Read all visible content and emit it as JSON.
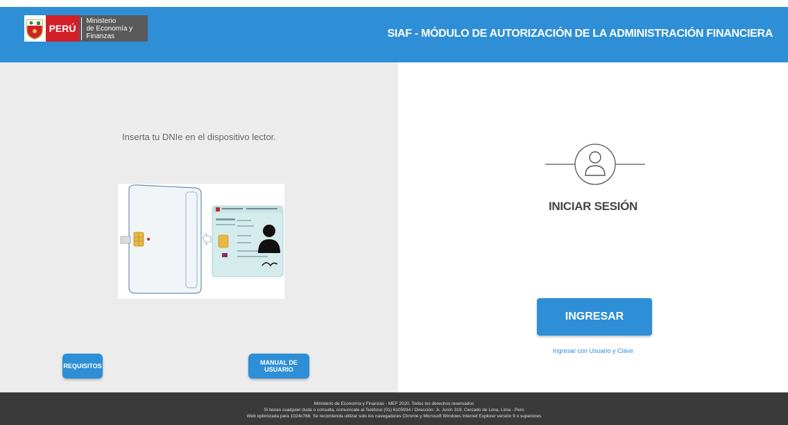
{
  "header": {
    "logo_peru": "PERÚ",
    "logo_ministry_line1": "Ministerio",
    "logo_ministry_line2": "de Economía y Finanzas",
    "title": "SIAF - MÓDULO DE AUTORIZACIÓN DE LA ADMINISTRACIÓN FINANCIERA"
  },
  "left": {
    "instruction": "Inserta tu DNIe en el dispositivo lector.",
    "requisitos_label": "REQUISITOS",
    "manual_label": "MANUAL DE USUARIO"
  },
  "right": {
    "title": "INICIAR SESIÓN",
    "ingresar_label": "INGRESAR",
    "alt_login_link": "Ingresar con Usuario y Clave"
  },
  "footer": {
    "line1": "Ministerio de Economía y Finanzas - MEF 2020. Todos los derechos reservados",
    "line2": "Si tienes cualquier duda o consulta, comunícate al Teléfono (01) 6105934 / Dirección: Jr. Junín 319, Cercado de Lima, Lima - Perú",
    "line3": "Web optimizada para 1024x768. Se recomienda utilizar solo los navegadores Chrome y Microsoft Windows Internet Explorer versión 9 o superiores"
  },
  "colors": {
    "accent": "#2e8fd6",
    "header_bg": "#2e8fd6",
    "footer_bg": "#3a3a3a",
    "left_panel_bg": "#ececec",
    "peru_red": "#d21f28"
  }
}
